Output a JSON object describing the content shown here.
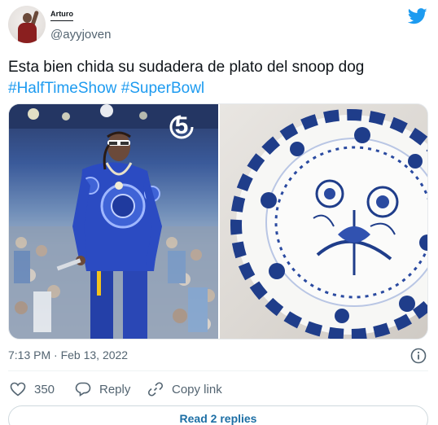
{
  "user": {
    "display_name": "Arturo",
    "handle": "@ayyjoven"
  },
  "tweet": {
    "text": "Esta bien chida su sudadera de plato del snoop dog",
    "hashtags": [
      "#HalfTimeShow",
      "#SuperBowl"
    ],
    "timestamp": "7:13 PM · Feb 13, 2022"
  },
  "media": {
    "left_image": "concert-performer-photo",
    "right_image": "blue-onion-porcelain-plate-photo",
    "channel_logo_text": "5"
  },
  "actions": {
    "like_count": "350",
    "reply_label": "Reply",
    "copy_label": "Copy link"
  },
  "read_replies_label": "Read 2 replies",
  "colors": {
    "accent": "#1d9bf0",
    "text": "#0f1419",
    "secondary_text": "#536471",
    "reply_link": "#1d6fa5"
  }
}
